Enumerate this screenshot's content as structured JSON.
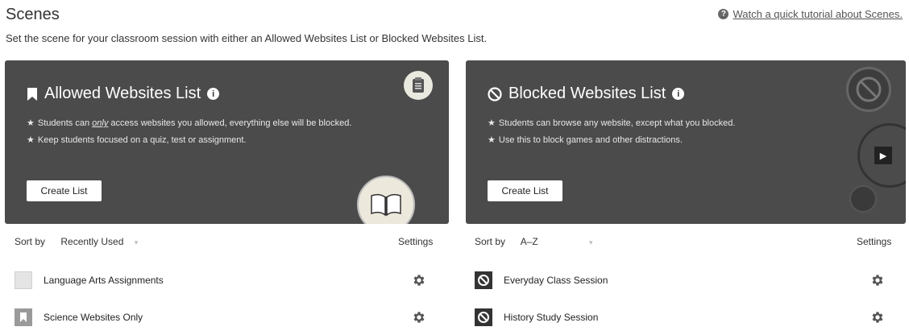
{
  "header": {
    "title": "Scenes",
    "tutorial_link": "Watch a quick tutorial about Scenes.",
    "subtitle": "Set the scene for your classroom session with either an Allowed Websites List or Blocked Websites List."
  },
  "allowed_card": {
    "title": "Allowed Websites List",
    "bullet1_pre": "Students can ",
    "bullet1_em": "only",
    "bullet1_post": " access websites you allowed, everything else will be blocked.",
    "bullet2": "Keep students focused on a quiz, test or assignment.",
    "button": "Create List",
    "bg_color": "#4b4b4b"
  },
  "blocked_card": {
    "title": "Blocked Websites List",
    "bullet1": "Students can browse any website, except what you blocked.",
    "bullet2": "Use this to block games and other distractions.",
    "button": "Create List",
    "bg_color": "#4b4b4b"
  },
  "allowed_list": {
    "sort_label": "Sort by",
    "sort_value": "Recently Used",
    "settings_label": "Settings",
    "items": [
      {
        "name": "Language Arts Assignments",
        "icon": "bookmark-thumb-icon"
      },
      {
        "name": "Science Websites Only",
        "icon": "bookmark-thumb-icon"
      }
    ]
  },
  "blocked_list": {
    "sort_label": "Sort by",
    "sort_value": "A–Z",
    "settings_label": "Settings",
    "items": [
      {
        "name": "Everyday Class Session",
        "icon": "ban-thumb-icon"
      },
      {
        "name": "History Study Session",
        "icon": "ban-thumb-icon"
      }
    ]
  }
}
